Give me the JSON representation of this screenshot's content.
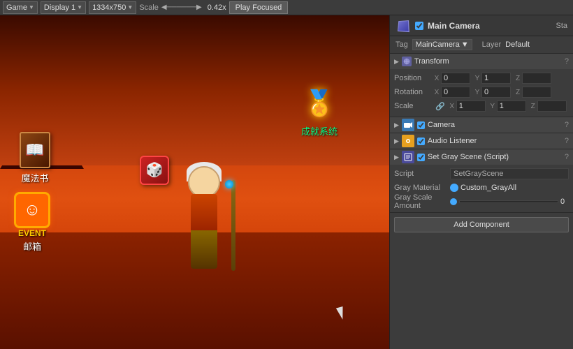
{
  "toolbar": {
    "game_label": "Game",
    "display_label": "Display 1",
    "resolution": "1334x750",
    "scale_label": "Scale",
    "scale_value": "0.42x",
    "play_focused": "Play Focused"
  },
  "inspector": {
    "object_name": "Main Camera",
    "stat_label": "Sta",
    "tag_label": "Tag",
    "tag_value": "MainCamera",
    "layer_label": "Layer",
    "layer_value": "Default",
    "transform": {
      "title": "Transform",
      "position_label": "Position",
      "pos_x": "0",
      "pos_y": "1",
      "pos_z": "",
      "rotation_label": "Rotation",
      "rot_x": "0",
      "rot_y": "0",
      "rot_z": "",
      "scale_label": "Scale",
      "scale_x": "1",
      "scale_y": "1",
      "scale_z": ""
    },
    "camera": {
      "title": "Camera"
    },
    "audio_listener": {
      "title": "Audio Listener"
    },
    "set_gray_scene": {
      "title": "Set Gray Scene (Script)",
      "script_label": "Script",
      "script_value": "SetGrayScene",
      "gray_material_label": "Gray Material",
      "gray_material_value": "Custom_GrayAll",
      "gray_scale_label": "Gray Scale Amount",
      "gray_scale_value": "0"
    },
    "add_component": "Add Component"
  },
  "game": {
    "book_label": "魔法书",
    "event_label": "EVENT",
    "event_smiley": "☺",
    "mail_label": "邮箱",
    "achievement_label": "成就系统",
    "achievement_emoji": "🏅"
  }
}
